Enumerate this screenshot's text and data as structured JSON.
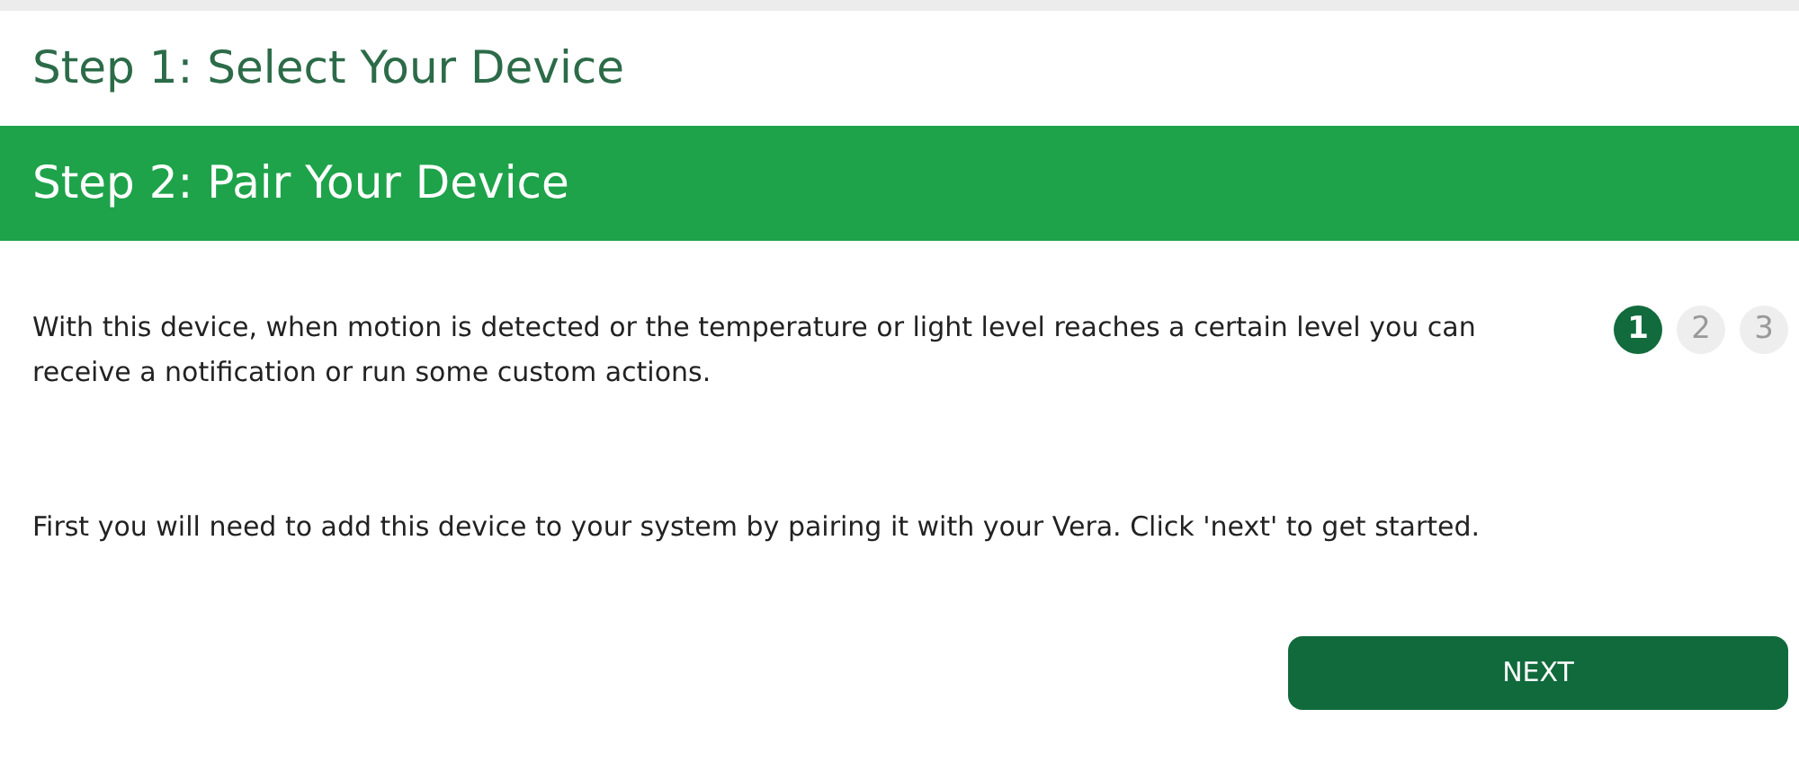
{
  "steps": [
    {
      "title": "Step 1: Select Your Device",
      "selected": false
    },
    {
      "title": "Step 2: Pair Your Device",
      "selected": true
    }
  ],
  "intro": "With this device, when motion is detected or the temperature or light level reaches a certain level you can receive a notification or run some custom actions.",
  "progress": [
    {
      "label": "1",
      "selected": true
    },
    {
      "label": "2",
      "selected": false
    },
    {
      "label": "3",
      "selected": false
    }
  ],
  "instruction": "First you will need to add this device to your system by pairing it with your Vera. Click 'next' to get started.",
  "next_button": "NEXT"
}
